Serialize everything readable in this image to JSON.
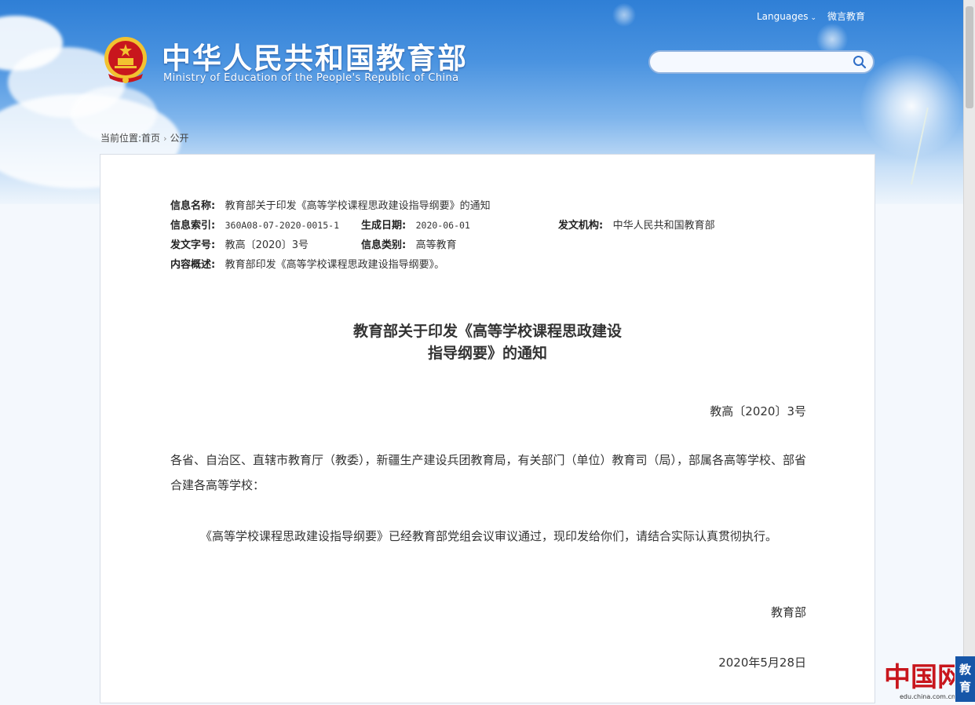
{
  "header": {
    "languages_label": "Languages",
    "weibo_label": "微言教育",
    "site_name_cn": "中华人民共和国教育部",
    "site_name_en": "Ministry of Education of the People's Republic of China",
    "search_placeholder": ""
  },
  "breadcrumb": {
    "prefix": "当前位置:",
    "home": "首页",
    "current": "公开"
  },
  "info": {
    "name_label": "信息名称:",
    "name_value": "教育部关于印发《高等学校课程思政建设指导纲要》的通知",
    "index_label": "信息索引:",
    "index_value": "360A08-07-2020-0015-1",
    "date_label": "生成日期:",
    "date_value": "2020-06-01",
    "issuer_label": "发文机构:",
    "issuer_value": "中华人民共和国教育部",
    "docno_label": "发文字号:",
    "docno_value": "教高〔2020〕3号",
    "category_label": "信息类别:",
    "category_value": "高等教育",
    "summary_label": "内容概述:",
    "summary_value": "教育部印发《高等学校课程思政建设指导纲要》。"
  },
  "article": {
    "title_line1": "教育部关于印发《高等学校课程思政建设",
    "title_line2": "指导纲要》的通知",
    "doc_number": "教高〔2020〕3号",
    "recipients": "各省、自治区、直辖市教育厅（教委），新疆生产建设兵团教育局，有关部门（单位）教育司（局），部属各高等学校、部省合建各高等学校：",
    "paragraph1": "《高等学校课程思政建设指导纲要》已经教育部党组会议审议通过，现印发给你们，请结合实际认真贯彻执行。",
    "signature": "教育部",
    "date": "2020年5月28日"
  },
  "footer_logo": {
    "china_net": "中国网",
    "china_url": "edu.china.com.cn",
    "edu_tag": "教育"
  },
  "colors": {
    "sky_top": "#2f7fd6",
    "edu_tag_bg": "#1656a8",
    "emblem_red": "#c8161d",
    "emblem_gold": "#f2c230"
  }
}
